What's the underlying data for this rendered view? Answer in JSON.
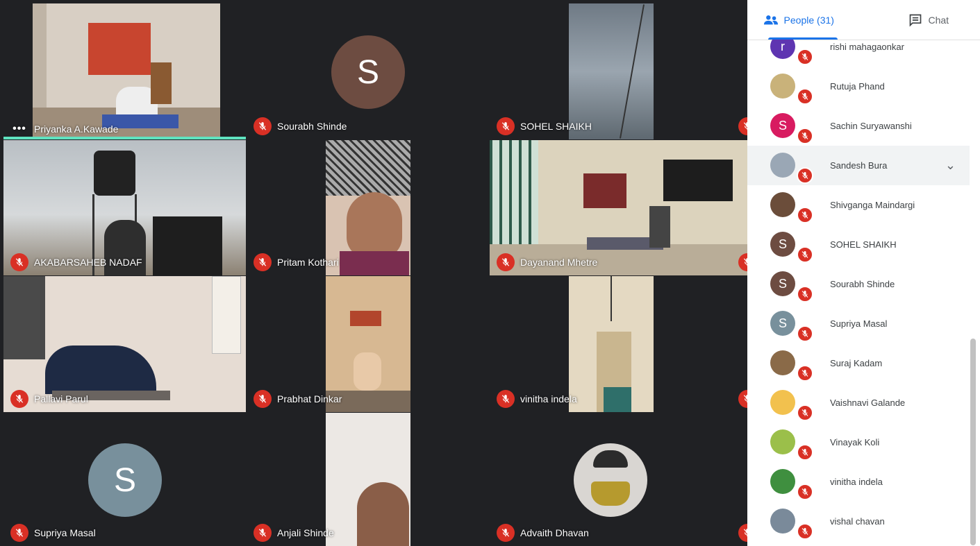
{
  "tabs": {
    "people_label": "People (31)",
    "chat_label": "Chat"
  },
  "tiles": {
    "t1": "Priyanka A.Kawade",
    "t2": "Sourabh Shinde",
    "t3": "SOHEL SHAIKH",
    "t4": "AKABARSAHEB NADAF",
    "t5": "Pritam Kothari",
    "t6": "Dayanand Mhetre",
    "t7": "Pallavi Parul",
    "t8": "Prabhat Dinkar",
    "t9": "vinitha indela",
    "t10": "Supriya Masal",
    "t11": "Anjali Shinde",
    "t12": "Advaith Dhavan"
  },
  "avatars": {
    "sourabh_initial": "S",
    "supriya_initial": "S"
  },
  "people": [
    {
      "name": "rishi mahagaonkar",
      "initial": "r",
      "color": "#5e35b1"
    },
    {
      "name": "Rutuja Phand",
      "initial": "",
      "color": "#c9b27a"
    },
    {
      "name": "Sachin Suryawanshi",
      "initial": "S",
      "color": "#d81b60"
    },
    {
      "name": "Sandesh Bura",
      "initial": "",
      "color": "#9aa7b5"
    },
    {
      "name": "Shivganga Maindargi",
      "initial": "",
      "color": "#6b4d3a"
    },
    {
      "name": "SOHEL SHAIKH",
      "initial": "S",
      "color": "#6d4c41"
    },
    {
      "name": "Sourabh Shinde",
      "initial": "S",
      "color": "#6d4c41"
    },
    {
      "name": "Supriya Masal",
      "initial": "S",
      "color": "#78909c"
    },
    {
      "name": "Suraj Kadam",
      "initial": "",
      "color": "#8a6a48"
    },
    {
      "name": "Vaishnavi Galande",
      "initial": "",
      "color": "#f2c14e"
    },
    {
      "name": "Vinayak Koli",
      "initial": "",
      "color": "#9bbf4a"
    },
    {
      "name": "vinitha indela",
      "initial": "",
      "color": "#3f8f3f"
    },
    {
      "name": "vishal chavan",
      "initial": "",
      "color": "#7a8a9a"
    }
  ],
  "colors": {
    "accent": "#1a73e8",
    "mute": "#d93025",
    "speaking": "#5fe3c0"
  }
}
